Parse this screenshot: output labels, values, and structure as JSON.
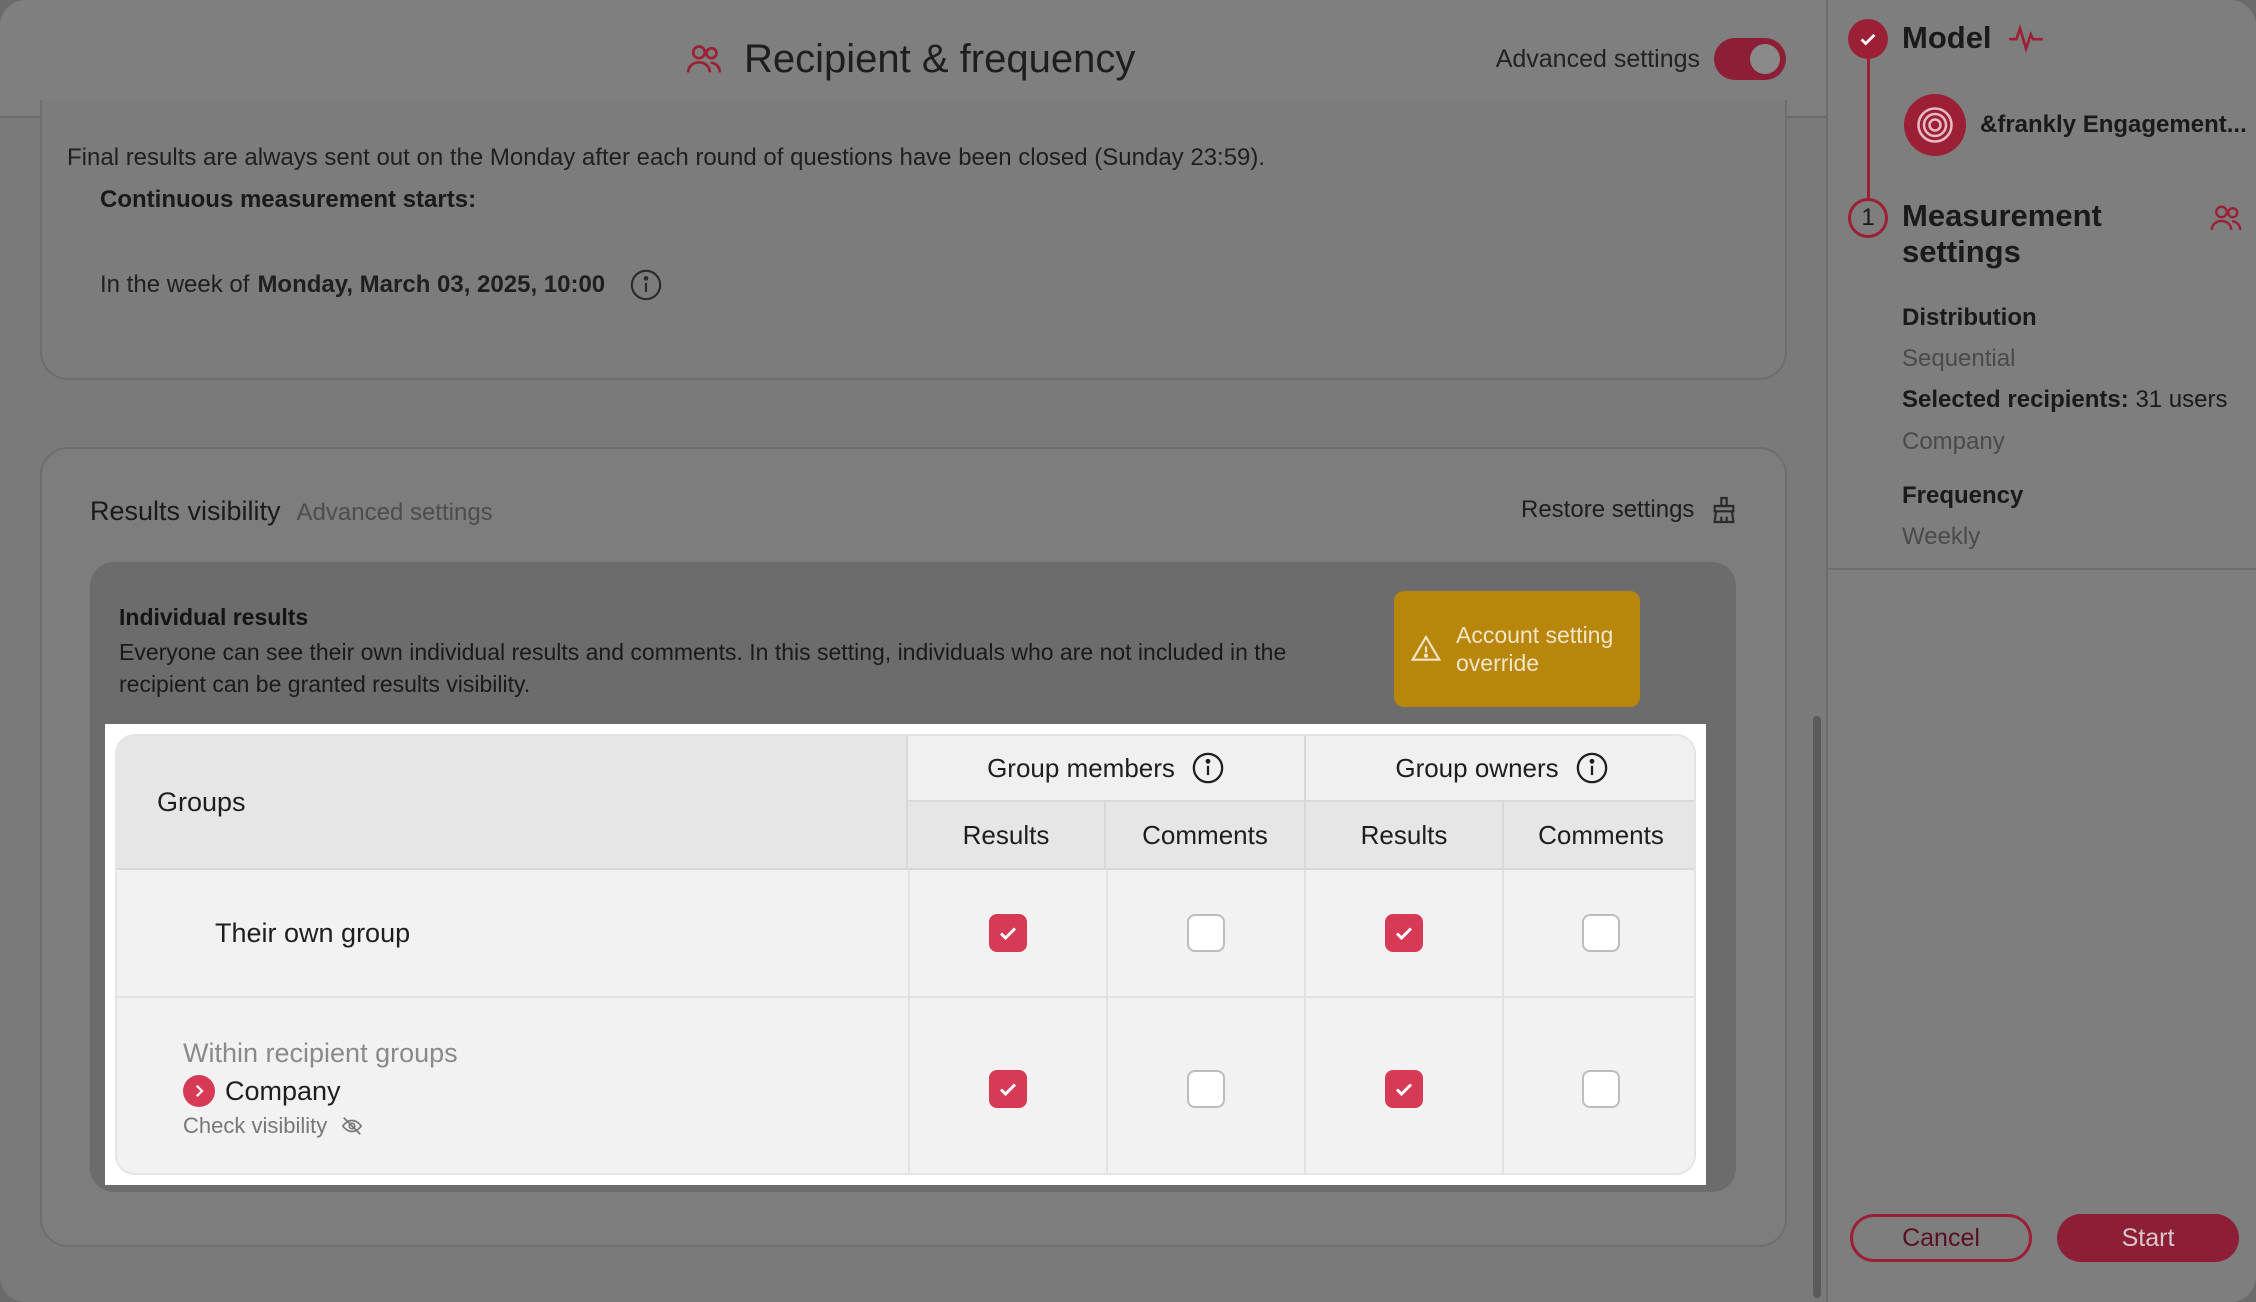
{
  "header": {
    "title": "Recipient & frequency",
    "advanced_label": "Advanced settings",
    "advanced_on": true
  },
  "schedule": {
    "final_results_note": "Final results are always sent out on the Monday after each round of questions have been closed (Sunday 23:59).",
    "continuous_label": "Continuous measurement starts:",
    "week_prefix": "In the week of",
    "week_date": "Monday, March 03, 2025, 10:00"
  },
  "results_visibility": {
    "title": "Results visibility",
    "subtitle": "Advanced settings",
    "restore_label": "Restore settings",
    "individual": {
      "title": "Individual results",
      "description": "Everyone can see their own individual results and comments. In this setting, individuals who are not included in the recipient can be granted results visibility.",
      "override_badge": "Account setting override"
    },
    "table": {
      "groups_header": "Groups",
      "group_members_header": "Group members",
      "group_owners_header": "Group owners",
      "sub_headers": [
        "Results",
        "Comments",
        "Results",
        "Comments"
      ],
      "rows": [
        {
          "label": "Their own group",
          "checks": [
            true,
            false,
            true,
            false
          ]
        },
        {
          "muted_label": "Within recipient groups",
          "label": "Company",
          "check_visibility": "Check visibility",
          "checks": [
            true,
            false,
            true,
            false
          ]
        }
      ]
    }
  },
  "sidebar": {
    "model_title": "Model",
    "model_name": "&frankly Engagement...",
    "step_number": "1",
    "measurement_title": "Measurement settings",
    "distribution_label": "Distribution",
    "distribution_value": "Sequential",
    "recipients_label": "Selected recipients:",
    "recipients_value": "31 users",
    "recipients_group": "Company",
    "frequency_label": "Frequency",
    "frequency_value": "Weekly",
    "cancel_label": "Cancel",
    "start_label": "Start"
  },
  "colors": {
    "accent": "#d63a55",
    "brand_dark": "#9b2036",
    "override_bg": "#b8860b"
  }
}
